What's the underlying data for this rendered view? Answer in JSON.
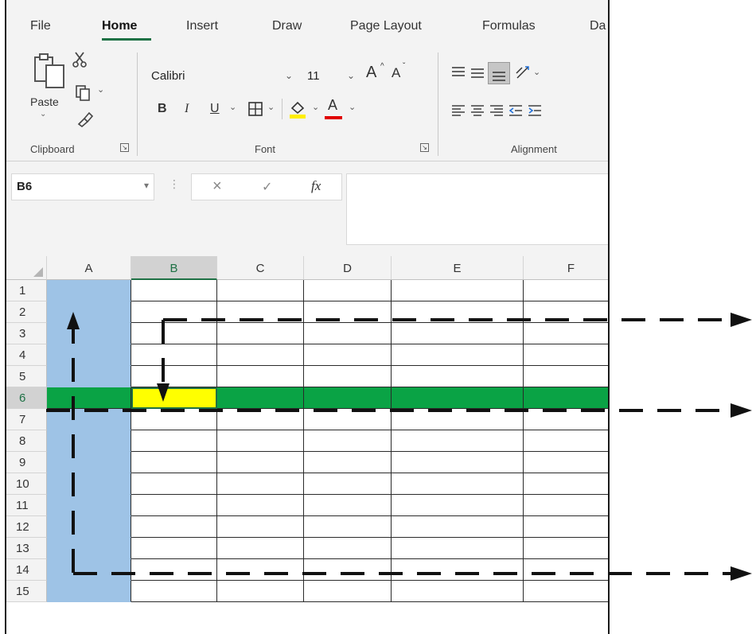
{
  "tabs": [
    "File",
    "Home",
    "Insert",
    "Draw",
    "Page Layout",
    "Formulas",
    "Da"
  ],
  "active_tab": "Home",
  "ribbon": {
    "clipboard": {
      "label": "Clipboard",
      "paste_label": "Paste"
    },
    "font": {
      "label": "Font",
      "font_name": "Calibri",
      "font_size": "11",
      "bold": "B",
      "italic": "I",
      "underline": "U",
      "font_color_letter": "A",
      "grow_letter": "A",
      "shrink_letter": "A"
    },
    "alignment": {
      "label": "Alignment"
    },
    "colors": {
      "fill_highlight": "#ffee00",
      "font_color": "#e00000",
      "accent": "#1e7145"
    }
  },
  "formula_bar": {
    "name_box": "B6",
    "fx": "fx",
    "cancel": "×",
    "enter": "✓"
  },
  "grid": {
    "columns": [
      "A",
      "B",
      "C",
      "D",
      "E",
      "F"
    ],
    "rows": [
      "1",
      "2",
      "3",
      "4",
      "5",
      "6",
      "7",
      "8",
      "9",
      "10",
      "11",
      "12",
      "13",
      "14",
      "15"
    ],
    "selected_column": "B",
    "selected_row": "6",
    "active_cell": "B6",
    "highlight_colors": {
      "column_a": "#9ec3e6",
      "row_6": "#0aa345",
      "active_cell": "#ffff00"
    }
  }
}
